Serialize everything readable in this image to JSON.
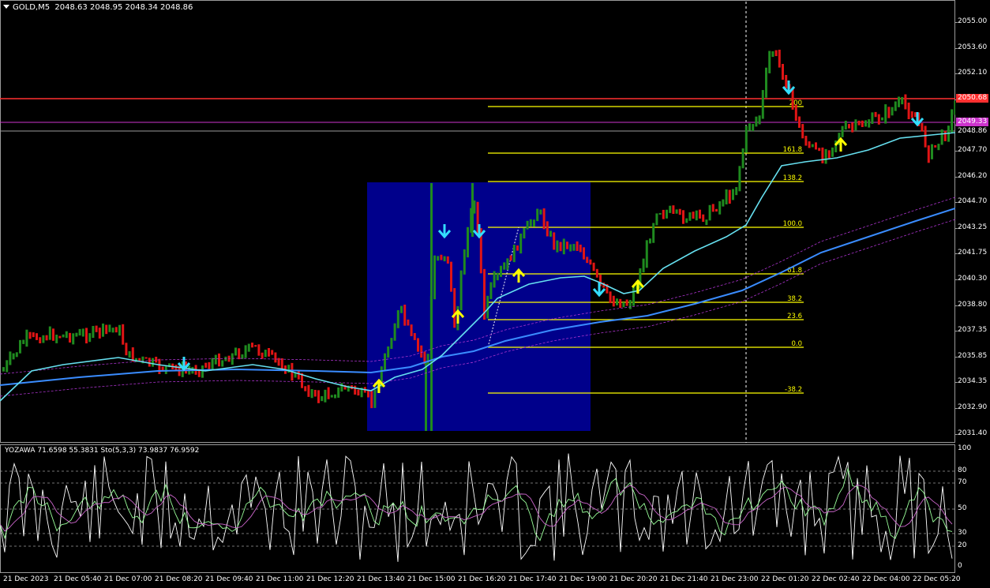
{
  "chart_header": {
    "symbol": "GOLD,M5",
    "ohlc": "2048.63 2048.95 2048.34 2048.86",
    "menu_glyph": "▼"
  },
  "oscillator": {
    "label": "YOZAWA 71.6598 55.3831 Sto(5,3,3) 73.9837 76.9592",
    "levels": [
      "100",
      "80",
      "70",
      "50",
      "30",
      "20",
      "0"
    ]
  },
  "price_axis": [
    "2055.00",
    "2053.60",
    "2052.10",
    "2050.65",
    "2049.15",
    "2047.70",
    "2046.20",
    "2044.70",
    "2043.25",
    "2041.75",
    "2040.30",
    "2038.80",
    "2037.35",
    "2035.85",
    "2034.35",
    "2032.90",
    "2031.40"
  ],
  "price_tags": [
    {
      "value": "2050.68",
      "color": "#ff3030",
      "text_color": "#ffffff"
    },
    {
      "value": "2049.33",
      "color": "#cc33cc",
      "text_color": "#ffffff"
    },
    {
      "value": "2048.86",
      "color": "#000000",
      "text_color": "#ffffff"
    }
  ],
  "time_axis": [
    "21 Dec 2023",
    "21 Dec 05:40",
    "21 Dec 07:00",
    "21 Dec 08:20",
    "21 Dec 09:40",
    "21 Dec 11:00",
    "21 Dec 12:20",
    "21 Dec 13:40",
    "21 Dec 15:00",
    "21 Dec 16:20",
    "21 Dec 17:40",
    "21 Dec 19:00",
    "21 Dec 20:20",
    "21 Dec 21:40",
    "21 Dec 23:00",
    "22 Dec 01:20",
    "22 Dec 02:40",
    "22 Dec 04:00",
    "22 Dec 05:20"
  ],
  "fibonacci_levels": [
    "200",
    "161.8",
    "138.2",
    "100.0",
    "61.8",
    "38.2",
    "23.6",
    "0.0",
    "-38.2"
  ],
  "colors": {
    "bull_bar": "#1f8a1f",
    "bear_bar": "#e01515",
    "ma_fast": "#66e0f0",
    "ma_slow": "#3a8cff",
    "envelope": "#aa33cc",
    "fib_line": "#ffff00",
    "box": "#00008b",
    "arrow_up": "#ffff00",
    "arrow_down": "#33ddff",
    "osc_line1": "#ffffff",
    "osc_line2": "#cc66cc",
    "osc_line3": "#99ff99"
  },
  "chart_data": {
    "type": "line",
    "title": "GOLD,M5",
    "y_range": [
      2031.4,
      2055.0
    ],
    "osc_range": [
      0,
      100
    ]
  }
}
